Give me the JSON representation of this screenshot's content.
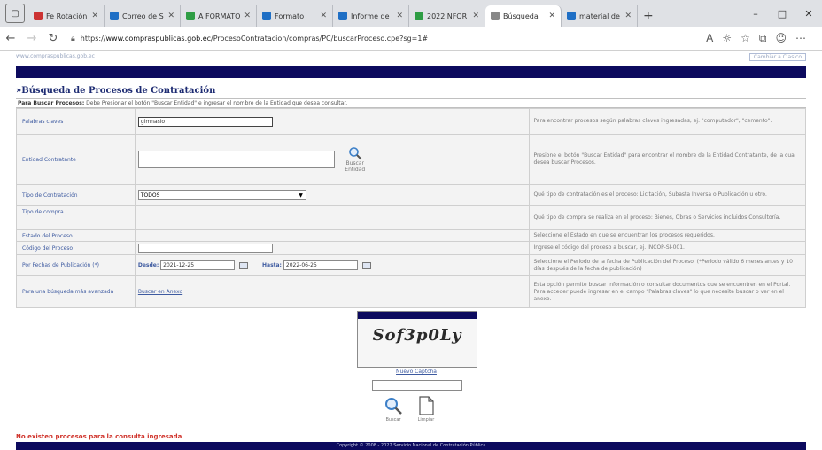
{
  "browser": {
    "tabs": [
      {
        "label": "Fe Rotación",
        "color": "#c33"
      },
      {
        "label": "Correo de S",
        "color": "#1f6fc5"
      },
      {
        "label": "A FORMATO",
        "color": "#2e9d44"
      },
      {
        "label": "Formato",
        "color": "#1f6fc5"
      },
      {
        "label": "Informe de",
        "color": "#1f6fc5"
      },
      {
        "label": "2022INFOR",
        "color": "#2e9d44"
      },
      {
        "label": "Búsqueda",
        "color": "#888888",
        "active": true
      },
      {
        "label": "material de",
        "color": "#1f6fc5"
      }
    ],
    "url_prefix": "https://",
    "url_host": "www.compraspublicas.gob.ec",
    "url_path": "/ProcesoContratacion/compras/PC/buscarProceso.cpe?sg=1#"
  },
  "page": {
    "top_left": "www.compraspublicas.gob.ec",
    "top_right": "Cambiar a Clasico",
    "title": "»Búsqueda de Procesos de Contratación",
    "instructions_bold": "Para Buscar Procesos:",
    "instructions": "Debe Presionar el botón \"Buscar Entidad\" e ingresar el nombre de la Entidad que desea consultar.",
    "form": {
      "keywords": {
        "label": "Palabras claves",
        "value": "gimnasio",
        "help": "Para encontrar procesos según palabras claves ingresadas, ej. \"computador\", \"cemento\"."
      },
      "entity": {
        "label": "Entidad Contratante",
        "value": "",
        "button": "Buscar Entidad",
        "help": "Presione el botón \"Buscar Entidad\" para encontrar el nombre de la Entidad Contratante, de la cual desea buscar Procesos."
      },
      "contract_type": {
        "label": "Tipo de Contratación",
        "value": "TODOS",
        "help": "Qué tipo de contratación es el proceso: Licitación, Subasta Inversa o Publicación u otro."
      },
      "purchase_type": {
        "label": "Tipo de compra",
        "help": "Qué tipo de compra se realiza en el proceso: Bienes, Obras o Servicios incluidos Consultoría."
      },
      "process_state": {
        "label": "Estado del Proceso",
        "help": "Seleccione el Estado en que se encuentran los procesos requeridos."
      },
      "process_code": {
        "label": "Código del Proceso",
        "value": "",
        "help": "Ingrese el código del proceso a buscar, ej. INCOP-SI-001."
      },
      "dates": {
        "label": "Por Fechas de Publicación (*)",
        "from_label": "Desde:",
        "from_value": "2021-12-25",
        "to_label": "Hasta:",
        "to_value": "2022-06-25",
        "help": "Seleccione el Período de la fecha de Publicación del Proceso. (*Período válido 6 meses antes y 10 días después de la fecha de publicación)"
      },
      "advanced": {
        "label": "Para una búsqueda más avanzada",
        "link": "Buscar en Anexo",
        "help": "Esta opción permite buscar información o consultar documentos que se encuentren en el Portal. Para acceder puede ingresar en el campo \"Palabras claves\" lo que necesite buscar o ver en el anexo."
      }
    },
    "captcha": {
      "text": "Sof3p0Ly",
      "refresh": "Nuevo Captcha",
      "value": ""
    },
    "actions": {
      "search": "Buscar",
      "clear": "Limpiar"
    },
    "no_results": "No existen procesos para la consulta ingresada",
    "footer": "Copyright © 2008 - 2022 Servicio Nacional de Contratación Pública"
  }
}
